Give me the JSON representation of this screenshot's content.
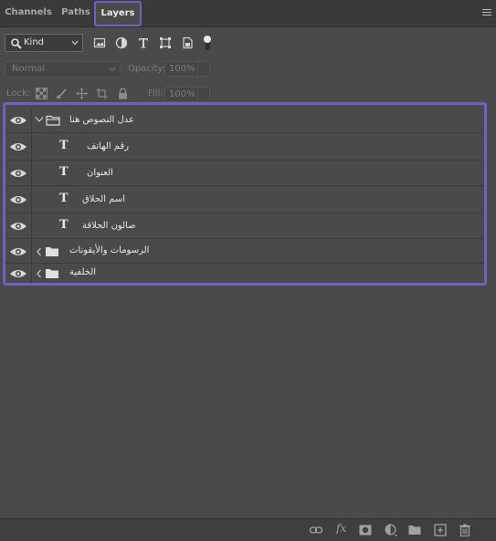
{
  "tabs": [
    {
      "label": "Channels",
      "active": false
    },
    {
      "label": "Paths",
      "active": false
    },
    {
      "label": "Layers",
      "active": true
    }
  ],
  "filter": {
    "kind_label": "Kind",
    "icons": [
      "image-filter-icon",
      "adjustment-filter-icon",
      "type-filter-icon",
      "shape-filter-icon",
      "smart-object-filter-icon",
      "filter-toggle-icon"
    ]
  },
  "blend": {
    "mode": "Normal",
    "opacity_label": "Opacity:",
    "opacity_value": "100%",
    "lock_label": "Lock:",
    "fill_label": "Fill:",
    "fill_value": "100%"
  },
  "layers": [
    {
      "name": "عدل النصوص هنا",
      "type": "group",
      "expanded": true,
      "visible": true
    },
    {
      "name": "رقم الهاتف",
      "type": "text",
      "indent": 1,
      "visible": true
    },
    {
      "name": "العنوان",
      "type": "text",
      "indent": 1,
      "visible": true
    },
    {
      "name": "اسم الحلاق",
      "type": "text",
      "indent": 1,
      "visible": true
    },
    {
      "name": "صالون الحلاقة",
      "type": "text",
      "indent": 1,
      "visible": true
    },
    {
      "name": "الرسومات والأيقونات",
      "type": "group",
      "expanded": false,
      "visible": true
    },
    {
      "name": "الخلفية",
      "type": "group",
      "expanded": false,
      "visible": true
    }
  ],
  "text_layer_glyph": "T",
  "footer_fx": "fx",
  "colors": {
    "accent": "#6b63c2",
    "panel": "#4a4a4a",
    "tabbar": "#3a3a3a"
  }
}
